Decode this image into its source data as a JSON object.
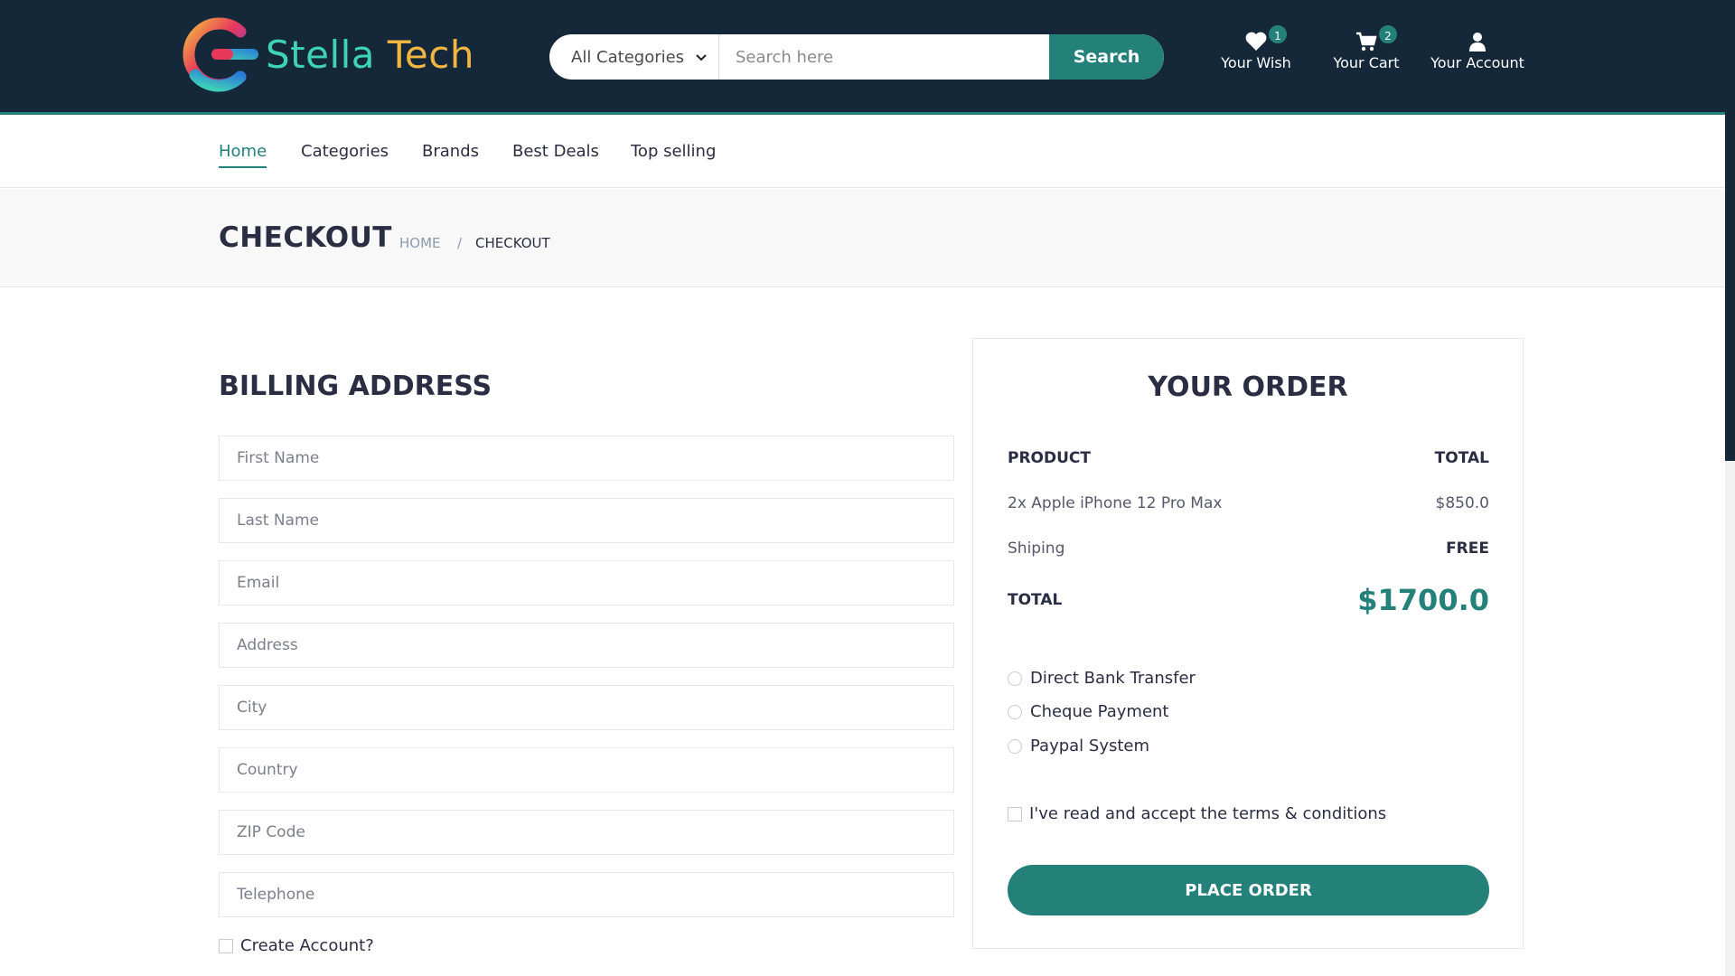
{
  "brand": {
    "name_part1": "Stella",
    "name_part2": "Tech",
    "colors": {
      "primary": "#23817a",
      "header_bg": "#15283a",
      "accent_yellow": "#f2b542",
      "accent_cyan": "#3fd3b6"
    }
  },
  "header": {
    "search": {
      "category": "All Categories",
      "placeholder": "Search here",
      "button_label": "Search"
    },
    "links": [
      {
        "label": "Your Wish",
        "icon": "heart-icon",
        "badge": "1"
      },
      {
        "label": "Your Cart",
        "icon": "cart-icon",
        "badge": "2"
      },
      {
        "label": "Your Account",
        "icon": "user-icon"
      }
    ]
  },
  "nav": {
    "items": [
      "Home",
      "Categories",
      "Brands",
      "Best Deals",
      "Top selling"
    ],
    "active": "Home"
  },
  "breadcrumb": {
    "title": "CHECKOUT",
    "home": "HOME",
    "separator": "/",
    "current": "CHECKOUT"
  },
  "billing": {
    "title": "BILLING ADDRESS",
    "fields": [
      "First Name",
      "Last Name",
      "Email",
      "Address",
      "City",
      "Country",
      "ZIP Code",
      "Telephone"
    ],
    "create_account": "Create Account?"
  },
  "order": {
    "title": "YOUR ORDER",
    "header_product": "PRODUCT",
    "header_total": "TOTAL",
    "item_name": "2x Apple iPhone 12 Pro Max",
    "item_price": "$850.0",
    "shipping_label": "Shiping",
    "shipping_value": "FREE",
    "total_label": "TOTAL",
    "total_value": "$1700.0",
    "payment_methods": [
      "Direct Bank Transfer",
      "Cheque Payment",
      "Paypal System"
    ],
    "terms": "I've read and accept the terms & conditions",
    "place_order": "PLACE ORDER"
  }
}
